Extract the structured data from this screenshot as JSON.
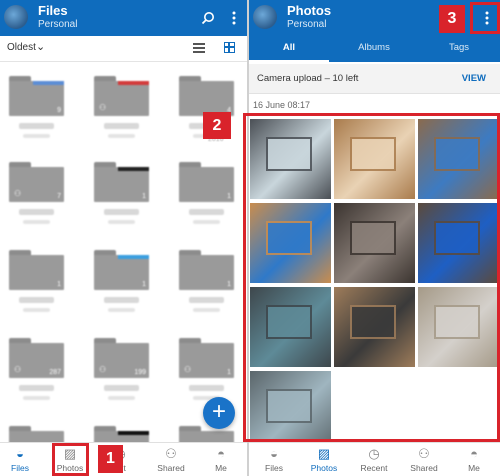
{
  "left": {
    "header": {
      "title": "Files",
      "subtitle": "Personal",
      "search_icon": "search-icon",
      "more_icon": "more-vert-icon"
    },
    "sort": {
      "label": "Oldest",
      "chevron": "chevron-down-icon",
      "list_view_icon": "list-view-icon",
      "grid_view_icon": "grid-view-icon"
    },
    "folders": [
      {
        "count": "9",
        "shared": false,
        "stripe": "#5b8dd6"
      },
      {
        "count": "",
        "shared": true,
        "stripe": "#d33a3a"
      },
      {
        "count": "4",
        "shared": false,
        "stripe": ""
      },
      {
        "count": "7",
        "shared": true,
        "stripe": ""
      },
      {
        "count": "1",
        "shared": false,
        "stripe": "#222222"
      },
      {
        "count": "1",
        "shared": false,
        "stripe": ""
      },
      {
        "count": "1",
        "shared": false,
        "stripe": ""
      },
      {
        "count": "1",
        "shared": false,
        "stripe": "#3a9fe0"
      },
      {
        "count": "1",
        "shared": false,
        "stripe": ""
      },
      {
        "count": "287",
        "shared": true,
        "stripe": ""
      },
      {
        "count": "199",
        "shared": true,
        "stripe": ""
      },
      {
        "count": "1",
        "shared": true,
        "stripe": ""
      },
      {
        "count": "",
        "shared": false,
        "stripe": ""
      },
      {
        "count": "",
        "shared": false,
        "stripe": "#111111"
      },
      {
        "count": "",
        "shared": false,
        "stripe": ""
      }
    ],
    "date_fragment": "2016",
    "fab_label": "+",
    "nav": [
      {
        "label": "Files",
        "icon": "files-icon",
        "glyph": "◒",
        "active": true
      },
      {
        "label": "Photos",
        "icon": "photos-icon",
        "glyph": "▨",
        "active": false
      },
      {
        "label": "ent",
        "icon": "recent-icon",
        "glyph": "◷",
        "active": false
      },
      {
        "label": "Shared",
        "icon": "shared-icon",
        "glyph": "⚇",
        "active": false
      },
      {
        "label": "Me",
        "icon": "me-icon",
        "glyph": "◓",
        "active": false
      }
    ]
  },
  "right": {
    "header": {
      "title": "Photos",
      "subtitle": "Personal",
      "more_icon": "more-vert-icon"
    },
    "tabs": [
      {
        "label": "All",
        "active": true
      },
      {
        "label": "Albums",
        "active": false
      },
      {
        "label": "Tags",
        "active": false
      }
    ],
    "upload": {
      "text": "Camera upload – 10 left",
      "action": "VIEW"
    },
    "date": "16 June  08:17",
    "photos": [
      {
        "desc": "laptop-window-view",
        "bg": "#4a4f55",
        "accent": "#c9d6dc"
      },
      {
        "desc": "latte-on-table",
        "bg": "#a97b4c",
        "accent": "#e9d2b4"
      },
      {
        "desc": "laptop-on-wood",
        "bg": "#8a6a4d",
        "accent": "#3d7bc2"
      },
      {
        "desc": "laptop-tiles-bright",
        "bg": "#c98d4e",
        "accent": "#2f79c9"
      },
      {
        "desc": "laptop-stand-dark",
        "bg": "#3b3430",
        "accent": "#8b8079"
      },
      {
        "desc": "laptop-tiles-blue",
        "bg": "#5b4a3c",
        "accent": "#1e5fc4"
      },
      {
        "desc": "laptop-teal-screen",
        "bg": "#3e474c",
        "accent": "#5e8a97"
      },
      {
        "desc": "laptop-side-view",
        "bg": "#9e7c5a",
        "accent": "#3a3a3a"
      },
      {
        "desc": "laptop-lid-silver",
        "bg": "#a59a88",
        "accent": "#d4d0cb"
      },
      {
        "desc": "laptop-logo-dark",
        "bg": "#5b666b",
        "accent": "#9fb5bf"
      }
    ],
    "nav": [
      {
        "label": "Files",
        "icon": "files-icon",
        "glyph": "◒",
        "active": false
      },
      {
        "label": "Photos",
        "icon": "photos-icon",
        "glyph": "▨",
        "active": true
      },
      {
        "label": "Recent",
        "icon": "recent-icon",
        "glyph": "◷",
        "active": false
      },
      {
        "label": "Shared",
        "icon": "shared-icon",
        "glyph": "⚇",
        "active": false
      },
      {
        "label": "Me",
        "icon": "me-icon",
        "glyph": "◓",
        "active": false
      }
    ]
  },
  "annotations": [
    {
      "number": "1",
      "target": "photos-nav-tab"
    },
    {
      "number": "2",
      "target": "photo-grid"
    },
    {
      "number": "3",
      "target": "more-menu"
    }
  ],
  "colors": {
    "accent": "#0f6cbd",
    "annotation": "#d9232b"
  }
}
